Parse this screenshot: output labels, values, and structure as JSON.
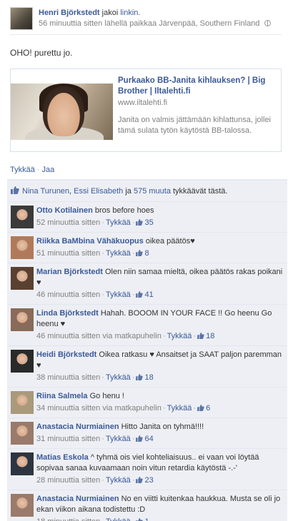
{
  "post": {
    "author": "Henri Björkstedt",
    "verb": "jakoi",
    "object": "linkin.",
    "meta": "56 minuuttia sitten lähellä paikkaa Järvenpää, Southern Finland",
    "status": "OHO! purettu jo."
  },
  "link": {
    "title": "Purkaako BB-Janita kihlauksen? | Big Brother | Iltalehti.fi",
    "url": "www.iltalehti.fi",
    "description": "Janita on valmis jättämään kihlattunsa, jollei tämä sulata tytön käytöstä BB-talossa."
  },
  "actions": {
    "like": "Tykkää",
    "separator": "·",
    "share": "Jaa"
  },
  "likes": {
    "name1": "Nina Turunen",
    "comma": ",",
    "name2": "Essi Elisabeth",
    "and": "ja",
    "others": "575 muuta",
    "suffix": "tykkäävät tästä."
  },
  "comments": [
    {
      "author": "Otto Kotilainen",
      "text": "bros before hoes",
      "time": "52 minuuttia sitten",
      "via": "",
      "like_label": "Tykkää",
      "likes": "35",
      "avatar_color": "#3a3a3a"
    },
    {
      "author": "Riikka BaMbina Vähäkuopus",
      "text": "oikea päätös♥",
      "time": "51 minuuttia sitten",
      "via": "",
      "like_label": "Tykkää",
      "likes": "8",
      "avatar_color": "#b07a5a"
    },
    {
      "author": "Marian Björkstedt",
      "text": "Olen niin samaa mieltä, oikea päätös rakas poikani ♥",
      "time": "46 minuuttia sitten",
      "via": "",
      "like_label": "Tykkää",
      "likes": "41",
      "avatar_color": "#5a4030"
    },
    {
      "author": "Linda Björkstedt",
      "text": "Hahah. BOOOM IN YOUR FACE !! Go heenu Go heenu ♥",
      "time": "46 minuuttia sitten",
      "via": "via matkapuhelin",
      "like_label": "Tykkää",
      "likes": "18",
      "avatar_color": "#8a6a58"
    },
    {
      "author": "Heidi Björkstedt",
      "text": "Oikea ratkasu ♥ Ansaitset ja SAAT paljon paremman ♥",
      "time": "38 minuuttia sitten",
      "via": "",
      "like_label": "Tykkää",
      "likes": "18",
      "avatar_color": "#2a2a2a"
    },
    {
      "author": "Riina Salmela",
      "text": "Go henu !",
      "time": "34 minuuttia sitten",
      "via": "via matkapuhelin",
      "like_label": "Tykkää",
      "likes": "6",
      "avatar_color": "#a89a7a"
    },
    {
      "author": "Anastacia Nurmiainen",
      "text": "Hitto Janita on tyhmä!!!!",
      "time": "31 minuuttia sitten",
      "via": "",
      "like_label": "Tykkää",
      "likes": "64",
      "avatar_color": "#9a7a6a"
    },
    {
      "author": "Matias Eskola",
      "text": "^ tyhmä ois viel kohteliaisuus.. ei vaan voi löytää sopivaa sanaa kuvaamaan noin vitun retardia käytöstä -.-'",
      "time": "28 minuuttia sitten",
      "via": "",
      "like_label": "Tykkää",
      "likes": "23",
      "avatar_color": "#2d3540"
    },
    {
      "author": "Anastacia Nurmiainen",
      "text": "No en viitti kuitenkaa haukkua. Musta se oli jo ekan viikon aikana todistettu :D",
      "time": "18 minuuttia sitten",
      "via": "",
      "like_label": "Tykkää",
      "likes": "1",
      "avatar_color": "#9a7a6a"
    }
  ],
  "colors": {
    "link": "#3b5998",
    "meta": "#808080",
    "feedback_bg": "#edeff4"
  }
}
